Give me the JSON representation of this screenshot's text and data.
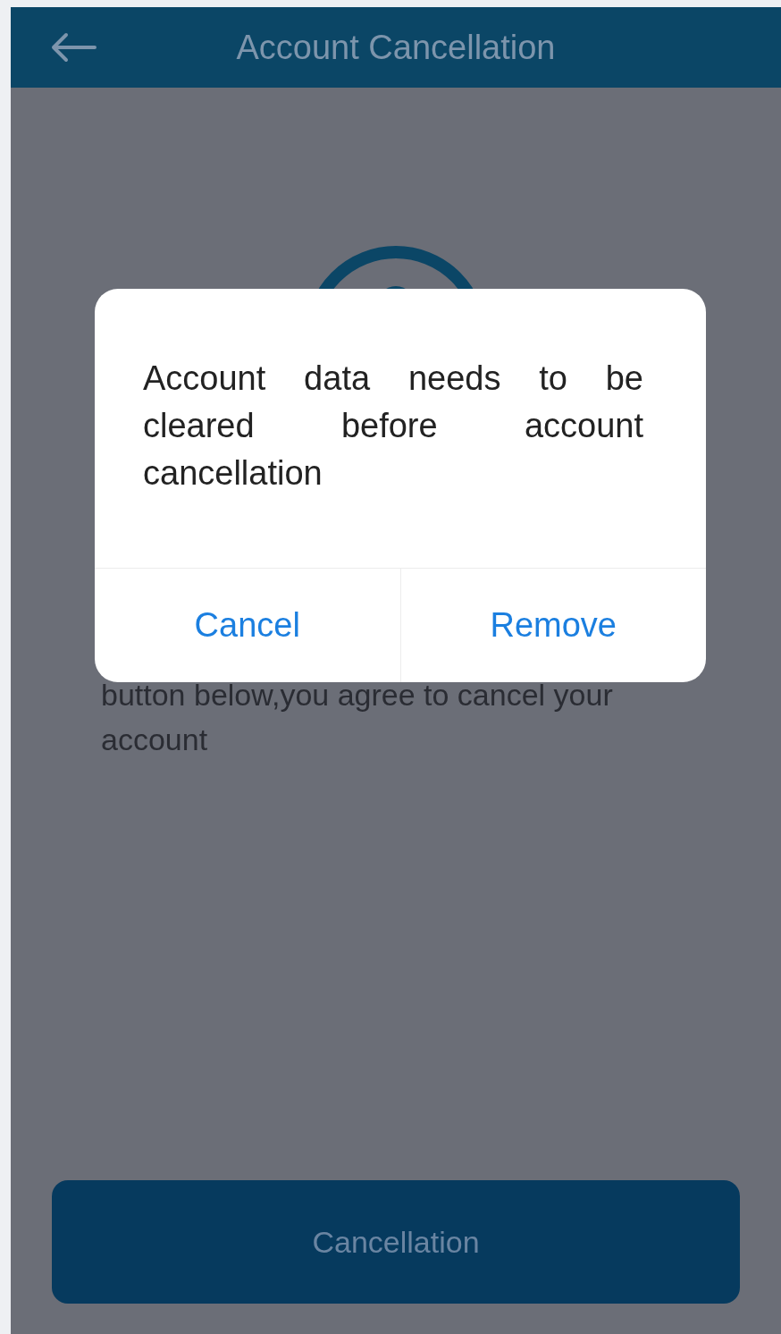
{
  "header": {
    "title": "Account Cancellation"
  },
  "notice": "button below,you agree to cancel your account",
  "primary_button": {
    "label": "Cancellation"
  },
  "dialog": {
    "message": "Account data needs to be cleared before account cancellation",
    "buttons": [
      {
        "label": "Cancel"
      },
      {
        "label": "Remove"
      }
    ]
  }
}
